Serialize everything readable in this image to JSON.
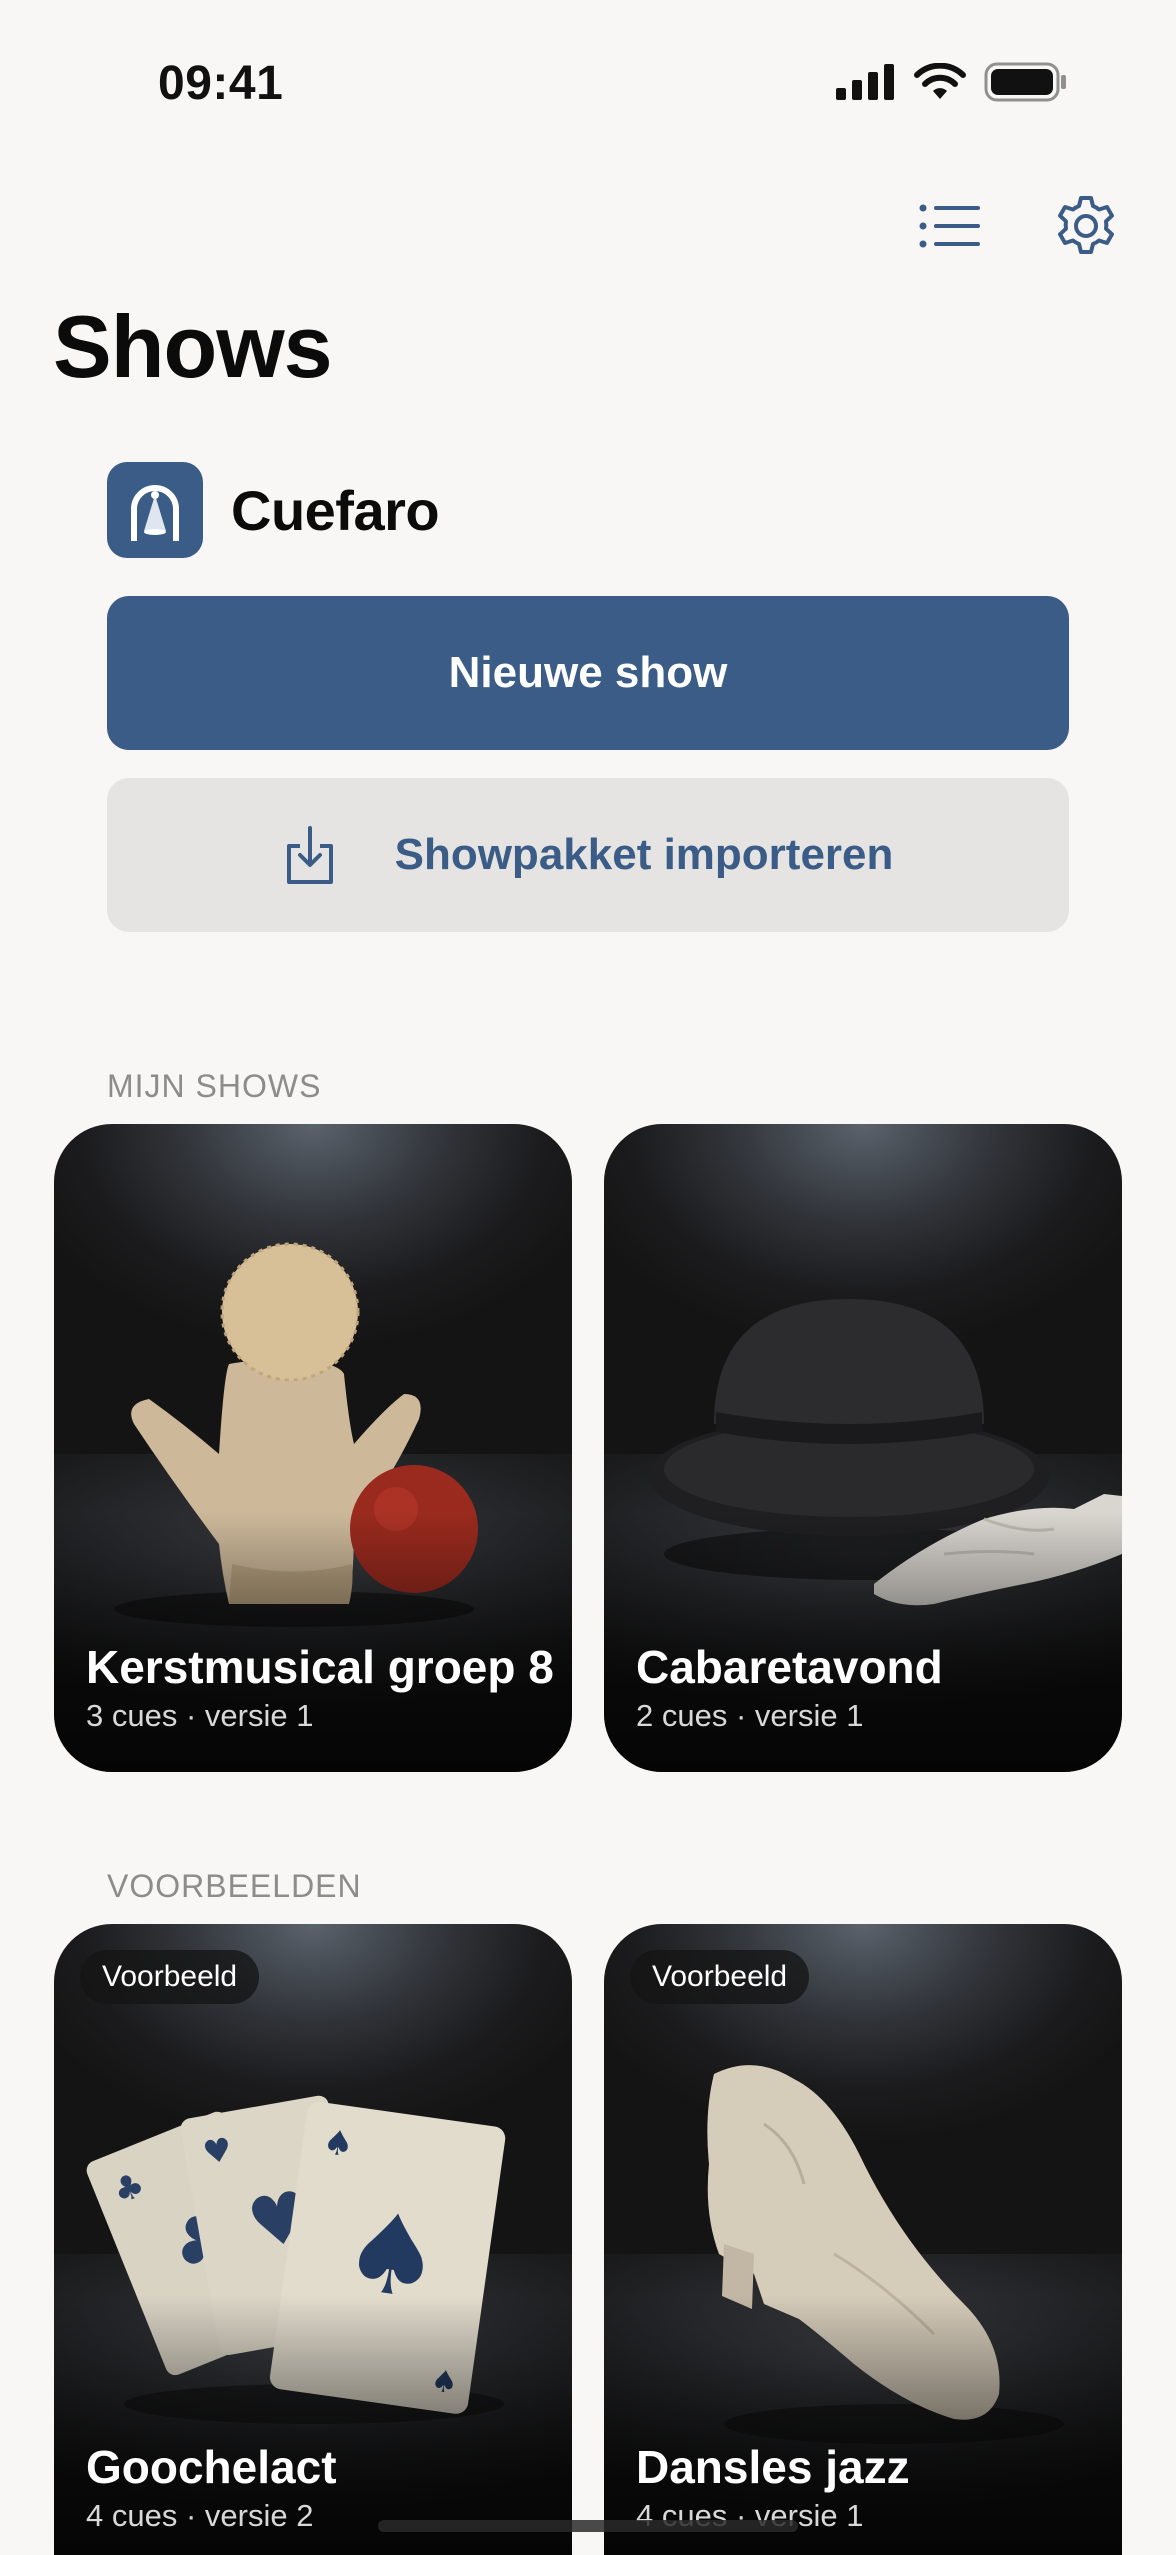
{
  "status_bar": {
    "time": "09:41"
  },
  "toolbar": {
    "list_icon": "list-icon",
    "settings_icon": "gear-icon"
  },
  "page": {
    "title": "Shows"
  },
  "brand": {
    "name": "Cuefaro",
    "logo_icon": "spotlight-logo-icon"
  },
  "actions": {
    "new_show": "Nieuwe show",
    "import_package": "Showpakket importeren",
    "import_icon": "download-tray-icon"
  },
  "my_shows": {
    "label": "MIJN SHOWS",
    "items": [
      {
        "title": "Kerstmusical groep 8",
        "meta": "3 cues · versie 1",
        "image": "hand-puppet-and-red-ball"
      },
      {
        "title": "Cabaretavond",
        "meta": "2 cues · versie 1",
        "image": "bowler-hat-and-gloves"
      }
    ]
  },
  "examples": {
    "label": "VOORBEELDEN",
    "items": [
      {
        "badge": "Voorbeeld",
        "title": "Goochelact",
        "meta": "4 cues · versie 2",
        "image": "playing-cards"
      },
      {
        "badge": "Voorbeeld",
        "title": "Dansles jazz",
        "meta": "4 cues · versie 1",
        "image": "jazz-shoe"
      }
    ]
  },
  "colors": {
    "accent": "#3a5c86",
    "background": "#f8f7f5",
    "secondary_button": "#e5e4e2"
  }
}
